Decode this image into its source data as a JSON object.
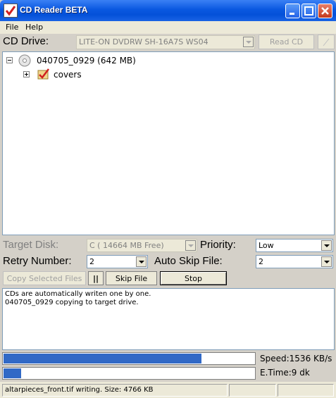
{
  "window": {
    "title": "CD Reader BETA"
  },
  "menu": {
    "file": "File",
    "help": "Help"
  },
  "cd_drive": {
    "label": "CD Drive:",
    "value": "LITE-ON DVDRW SH-16A7S  WS04",
    "read_button": "Read CD"
  },
  "tree": {
    "root_label": "040705_0929 (642 MB)",
    "child_label": "covers"
  },
  "settings": {
    "target_disk_label": "Target Disk:",
    "target_disk_value": "C ( 14664 MB Free)",
    "priority_label": "Priority:",
    "priority_value": "Low",
    "retry_label": "Retry Number:",
    "retry_value": "2",
    "auto_skip_label": "Auto Skip File:",
    "auto_skip_value": "2"
  },
  "actions": {
    "copy_selected": "Copy Selected Files",
    "pause": "||",
    "skip_file": "Skip File",
    "stop": "Stop"
  },
  "log": {
    "line1": "CDs are automatically writen one by one.",
    "line2": "040705_0929  copying to target drive."
  },
  "progress": {
    "overall_fraction": 0.79,
    "file_fraction": 0.07,
    "speed": "Speed:1536 KB/s",
    "etime": "E.Time:9 dk"
  },
  "status": {
    "text": "altarpieces_front.tif writing. Size: 4766 KB"
  }
}
